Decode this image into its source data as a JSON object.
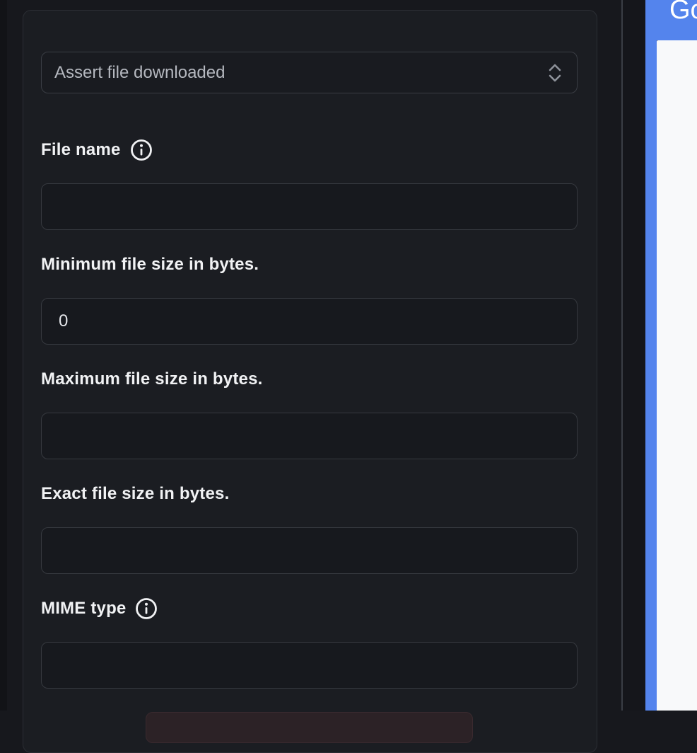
{
  "step_editor": {
    "action_select": {
      "value": "Assert file downloaded"
    },
    "fields": [
      {
        "label": "File name",
        "has_info": true,
        "value": ""
      },
      {
        "label": "Minimum file size in bytes.",
        "has_info": false,
        "value": "0"
      },
      {
        "label": "Maximum file size in bytes.",
        "has_info": false,
        "value": ""
      },
      {
        "label": "Exact file size in bytes.",
        "has_info": false,
        "value": ""
      },
      {
        "label": "MIME type",
        "has_info": true,
        "value": ""
      }
    ],
    "icons": {
      "select_chevron": "up-down-chevron-icon",
      "info": "info-circle-icon"
    }
  },
  "preview": {
    "heading_fragment": "Go"
  },
  "colors": {
    "accent_blue": "#5484ed",
    "preview_page_bg": "#f8f9fa",
    "danger_button_bg": "#2c2226",
    "card_bg": "#1b1d22",
    "page_bg": "#17181d",
    "label_text": "#f1f2f4",
    "muted_text": "#b5b8bf"
  }
}
